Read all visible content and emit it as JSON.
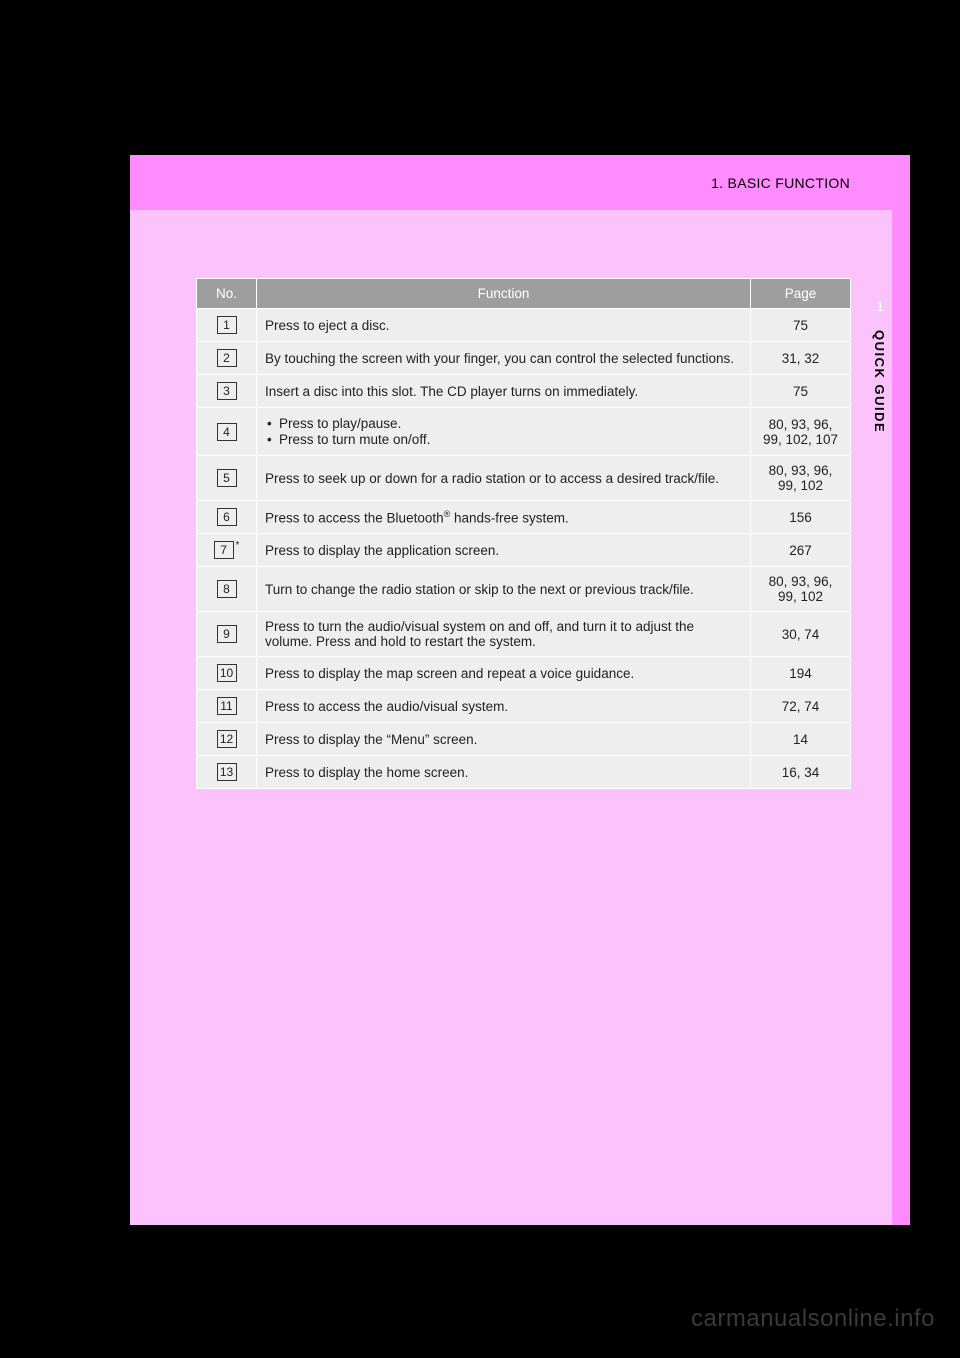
{
  "header": {
    "breadcrumb": "1. BASIC FUNCTION",
    "chapter_number": "1",
    "side_label": "QUICK GUIDE"
  },
  "table": {
    "columns": {
      "no": "No.",
      "function": "Function",
      "page": "Page"
    },
    "rows": [
      {
        "no": "1",
        "function_plain": "Press to eject a disc.",
        "page": "75"
      },
      {
        "no": "2",
        "function_plain": "By touching the screen with your finger, you can control the selected functions.",
        "page": "31, 32"
      },
      {
        "no": "3",
        "function_plain": "Insert a disc into this slot. The CD player turns on immediately.",
        "page": "75"
      },
      {
        "no": "4",
        "function_bullets": [
          "Press to play/pause.",
          "Press to turn mute on/off."
        ],
        "page": "80, 93, 96, 99, 102, 107"
      },
      {
        "no": "5",
        "function_plain": "Press to seek up or down for a radio station or to access a desired track/file.",
        "page": "80, 93, 96, 99, 102"
      },
      {
        "no": "6",
        "function_html": "Press to access the Bluetooth<sup>®</sup> hands-free system.",
        "page": "156"
      },
      {
        "no": "7",
        "no_suffix": "*",
        "function_plain": "Press to display the application screen.",
        "page": "267"
      },
      {
        "no": "8",
        "function_plain": "Turn to change the radio station or skip to the next or previous track/file.",
        "page": "80, 93, 96, 99, 102"
      },
      {
        "no": "9",
        "function_plain": "Press to turn the audio/visual system on and off, and turn it to adjust the volume. Press and hold to restart the system.",
        "page": "30, 74"
      },
      {
        "no": "10",
        "function_plain": "Press to display the map screen and repeat a voice guidance.",
        "page": "194"
      },
      {
        "no": "11",
        "function_plain": "Press to access the audio/visual system.",
        "page": "72, 74"
      },
      {
        "no": "12",
        "function_plain": "Press to display the “Menu” screen.",
        "page": "14"
      },
      {
        "no": "13",
        "function_plain": "Press to display the home screen.",
        "page": "16, 34"
      }
    ]
  },
  "watermark": "carmanualsonline.info"
}
